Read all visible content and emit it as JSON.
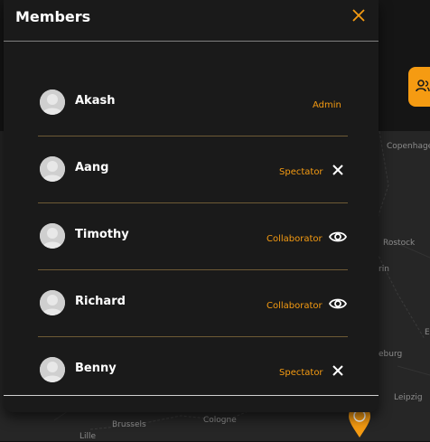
{
  "modal": {
    "title": "Members"
  },
  "members": [
    {
      "name": "Akash",
      "role": "Admin",
      "action": "none"
    },
    {
      "name": "Aang",
      "role": "Spectator",
      "action": "remove"
    },
    {
      "name": "Timothy",
      "role": "Collaborator",
      "action": "view"
    },
    {
      "name": "Richard",
      "role": "Collaborator",
      "action": "view"
    },
    {
      "name": "Benny",
      "role": "Spectator",
      "action": "remove"
    }
  ],
  "map": {
    "cities": [
      "Copenhagen",
      "Rostock",
      "Leipzig",
      "Brussels",
      "Cologne",
      "Lille",
      "rin",
      "eburg",
      "E"
    ]
  },
  "colors": {
    "accent": "#f59b12",
    "modal_bg": "#1a1a1a",
    "map_bg": "#262626"
  },
  "icons": {
    "close": "close-icon",
    "view": "eye-icon",
    "remove": "x-icon",
    "members": "users-icon",
    "marker": "map-marker-icon"
  }
}
